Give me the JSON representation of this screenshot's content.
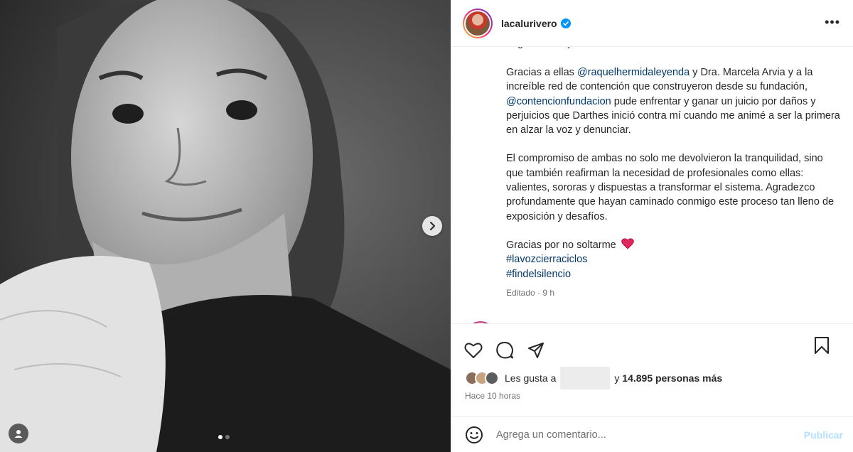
{
  "post": {
    "username": "lacalurivero",
    "caption_cut": "largo como injusto.",
    "p1_a": "Gracias a ellas ",
    "p1_mention1": "@raquelhermidaleyenda",
    "p1_b": " y Dra. Marcela Arvia y a la increíble red de contención que construyeron desde su fundación, ",
    "p1_mention2": "@contencionfundacion",
    "p1_c": " pude enfrentar y ganar un juicio por daños y perjuicios que Darthes inició contra mí cuando me animé a ser la primera en alzar la voz y denunciar.",
    "p2": "El compromiso de ambas no solo me devolvieron la tranquilidad, sino que también reafirman la necesidad de profesionales como ellas: valientes, sororas y dispuestas a transformar el sistema. Agradezco profundamente que hayan caminado conmigo este proceso tan lleno de exposición y desafíos.",
    "p3": "Gracias por no soltarme",
    "hashtag1": "#lavozcierraciclos",
    "hashtag2": "#findelsilencio",
    "edited": "Editado · 9 h"
  },
  "likes": {
    "prefix": "Les gusta a",
    "suffix": "y",
    "count": "14.895 personas más"
  },
  "time_ago": "Hace 10 horas",
  "comment": {
    "placeholder": "Agrega un comentario...",
    "publish_label": "Publicar"
  },
  "colors": {
    "link": "#00376b",
    "verified": "#0095f6",
    "heart": "#e0245e"
  }
}
